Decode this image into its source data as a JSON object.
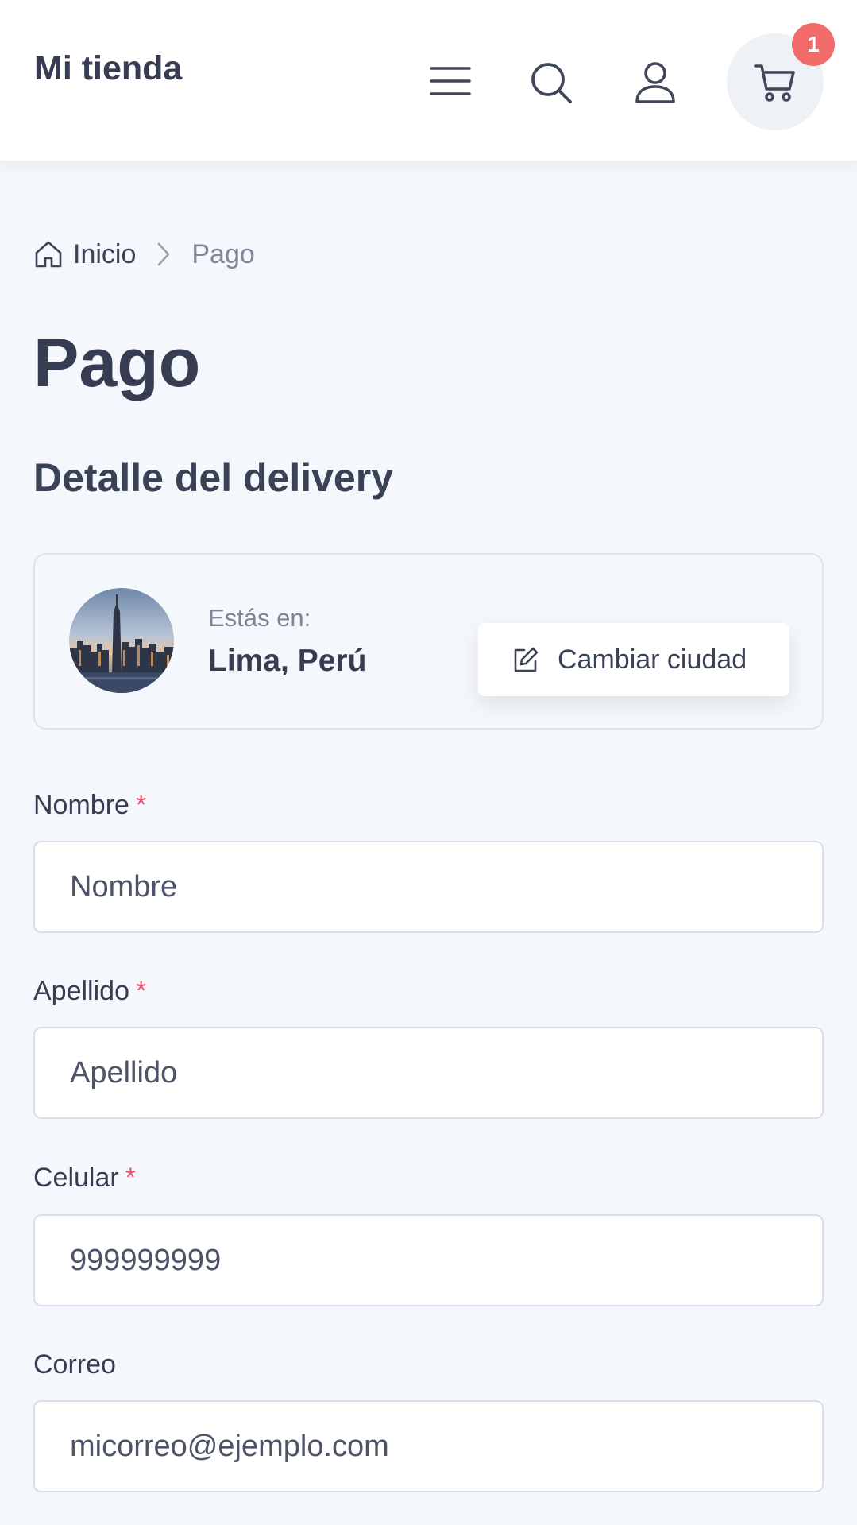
{
  "header": {
    "brand": "Mi tienda",
    "menu_icon": "hamburger-menu-icon",
    "search_icon": "search-icon",
    "account_icon": "user-icon",
    "cart_icon": "shopping-cart-icon",
    "cart_count": "1",
    "badge_color": "#f26b6b"
  },
  "breadcrumb": {
    "home_icon": "home-icon",
    "home_label": "Inicio",
    "current": "Pago"
  },
  "page": {
    "title": "Pago",
    "section_title": "Detalle del delivery"
  },
  "city_card": {
    "photo": "city-skyline-photo",
    "caption": "Estás en:",
    "city": "Lima, Perú",
    "change_button": "Cambiar ciudad",
    "change_icon": "edit-icon"
  },
  "form": {
    "required_mark": "*",
    "required_color": "#ef4f6b",
    "fields": [
      {
        "label": "Nombre",
        "required": true,
        "value": "",
        "placeholder": "Nombre"
      },
      {
        "label": "Apellido",
        "required": true,
        "value": "",
        "placeholder": "Apellido"
      },
      {
        "label": "Celular",
        "required": true,
        "value": "",
        "placeholder": "999999999"
      },
      {
        "label": "Correo",
        "required": false,
        "value": "",
        "placeholder": "micorreo@ejemplo.com"
      }
    ]
  }
}
